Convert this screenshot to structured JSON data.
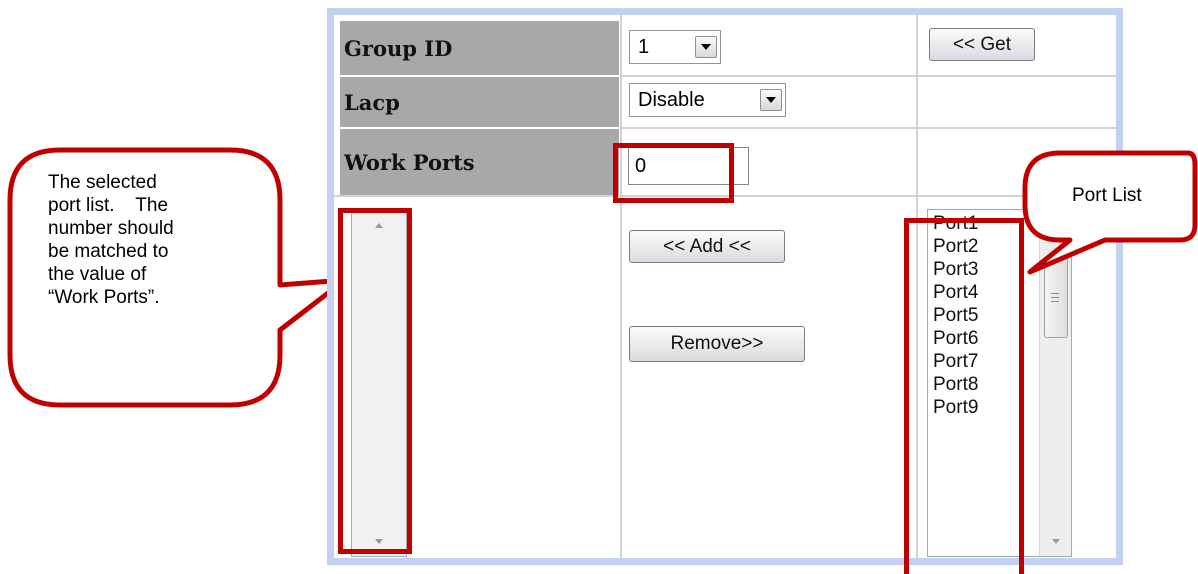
{
  "form": {
    "group_id": {
      "label": "Group ID",
      "value": "1",
      "get_button": "<< Get"
    },
    "lacp": {
      "label": "Lacp",
      "value": "Disable"
    },
    "work_ports": {
      "label": "Work Ports",
      "value": "0"
    },
    "add_button": "<< Add <<",
    "remove_button": "Remove>>",
    "port_list": [
      "Port1",
      "Port2",
      "Port3",
      "Port4",
      "Port5",
      "Port6",
      "Port7",
      "Port8",
      "Port9"
    ]
  },
  "annotations": {
    "selected_list_callout": [
      "The selected",
      "port list.    The",
      "number should",
      "be matched to",
      "the value of",
      "“Work Ports”."
    ],
    "port_list_callout": "Port List"
  },
  "colors": {
    "highlight": "#c00000",
    "frame": "#c2d1ef",
    "label_bg": "#aaa7aa"
  }
}
